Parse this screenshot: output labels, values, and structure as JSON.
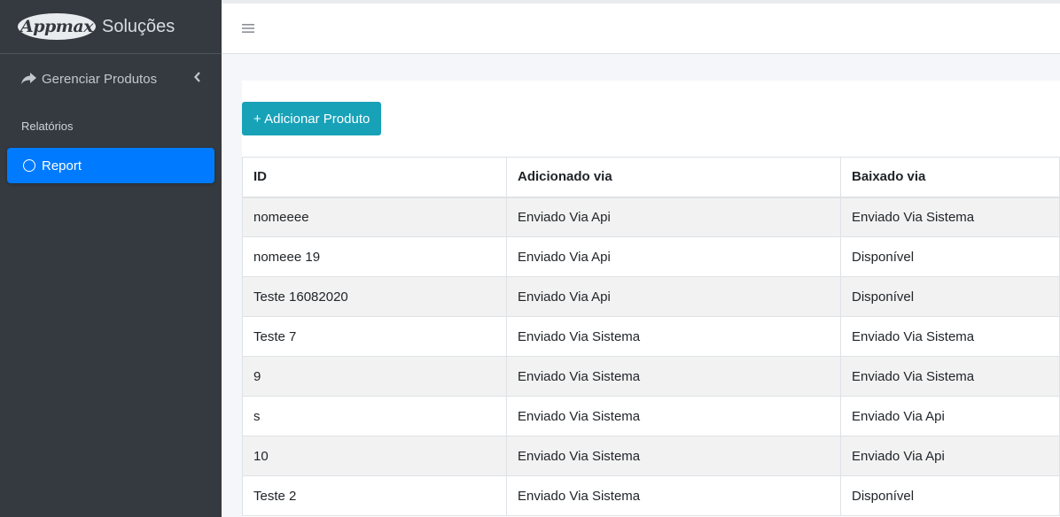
{
  "brand": {
    "logo_text": "Appmax",
    "title": "Soluções"
  },
  "sidebar": {
    "menu_item": {
      "label": "Gerenciar Produtos",
      "icon": "share-arrow-icon"
    },
    "section_header": "Relatórios",
    "active_item": {
      "label": "Report",
      "icon": "circle-icon"
    }
  },
  "topbar": {
    "menu_icon": "hamburger-icon"
  },
  "main": {
    "add_button": "+ Adicionar Produto",
    "table": {
      "headers": [
        "ID",
        "Adicionado via",
        "Baixado via"
      ],
      "rows": [
        [
          "nomeeee",
          "Enviado Via Api",
          "Enviado Via Sistema"
        ],
        [
          "nomeee 19",
          "Enviado Via Api",
          "Disponível"
        ],
        [
          "Teste 16082020",
          "Enviado Via Api",
          "Disponível"
        ],
        [
          "Teste 7",
          "Enviado Via Sistema",
          "Enviado Via Sistema"
        ],
        [
          "9",
          "Enviado Via Sistema",
          "Enviado Via Sistema"
        ],
        [
          "s",
          "Enviado Via Sistema",
          "Enviado Via Api"
        ],
        [
          "10",
          "Enviado Via Sistema",
          "Enviado Via Api"
        ],
        [
          "Teste 2",
          "Enviado Via Sistema",
          "Disponível"
        ]
      ]
    }
  },
  "colors": {
    "sidebar_bg": "#343a40",
    "active": "#007bff",
    "button": "#17a2b8"
  }
}
